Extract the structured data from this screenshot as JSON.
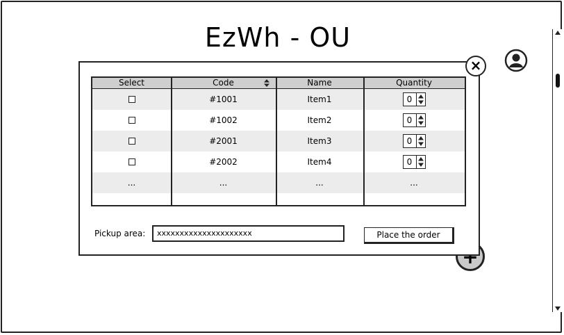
{
  "app": {
    "title": "EzWh - OU"
  },
  "table": {
    "columns": [
      "Select",
      "Code",
      "Name",
      "Quantity"
    ],
    "rows": [
      {
        "code": "#1001",
        "name": "Item1",
        "quantity": "0"
      },
      {
        "code": "#1002",
        "name": "Item2",
        "quantity": "0"
      },
      {
        "code": "#2001",
        "name": "Item3",
        "quantity": "0"
      },
      {
        "code": "#2002",
        "name": "Item4",
        "quantity": "0"
      }
    ],
    "ellipsis": "..."
  },
  "form": {
    "pickup_label": "Pickup area:",
    "pickup_value": "xxxxxxxxxxxxxxxxxxxxx",
    "place_order_label": "Place the order"
  },
  "icons": {
    "close": "close-icon",
    "user": "user-avatar-icon",
    "add": "add-icon",
    "sort": "sort-icon"
  }
}
